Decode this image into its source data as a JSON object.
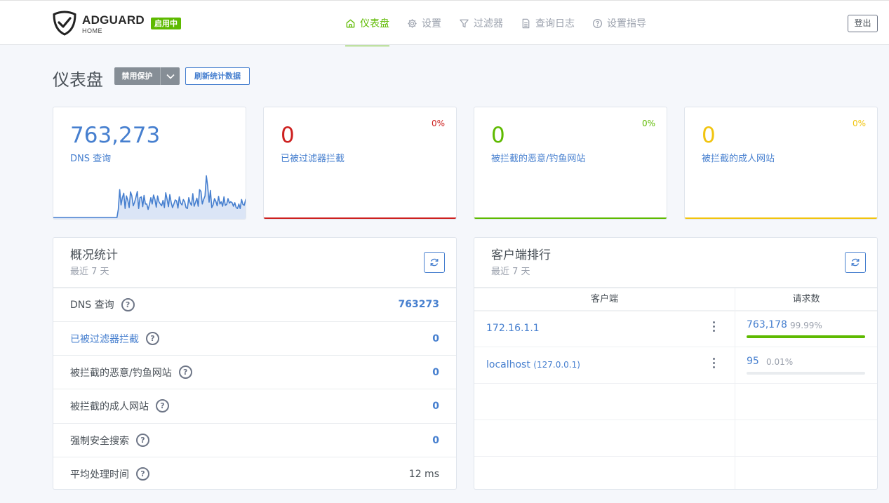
{
  "header": {
    "brand": "ADGUARD",
    "brand_sub": "HOME",
    "status_badge": "启用中",
    "nav": [
      {
        "label": "仪表盘",
        "icon": "home-icon",
        "active": true
      },
      {
        "label": "设置",
        "icon": "gear-icon",
        "active": false
      },
      {
        "label": "过滤器",
        "icon": "filter-icon",
        "active": false
      },
      {
        "label": "查询日志",
        "icon": "document-icon",
        "active": false
      },
      {
        "label": "设置指导",
        "icon": "help-icon",
        "active": false
      }
    ],
    "logout": "登出"
  },
  "page": {
    "title": "仪表盘",
    "disable_protection": "禁用保护",
    "refresh_stats": "刷新统计数据"
  },
  "stats": [
    {
      "value": "763,273",
      "label": "DNS 查询",
      "percent": "",
      "color": "#467fcf"
    },
    {
      "value": "0",
      "label": "已被过滤器拦截",
      "percent": "0%",
      "color": "#cd201f"
    },
    {
      "value": "0",
      "label": "被拦截的恶意/钓鱼网站",
      "percent": "0%",
      "color": "#5eba00"
    },
    {
      "value": "0",
      "label": "被拦截的成人网站",
      "percent": "0%",
      "color": "#f1c40f"
    }
  ],
  "sparkline": [
    0,
    0,
    0,
    0,
    0,
    0,
    0,
    0,
    0,
    0,
    0,
    0,
    0,
    0,
    0,
    0,
    0,
    0,
    0,
    0,
    0,
    0,
    0,
    0,
    0,
    0,
    0,
    0,
    0,
    0,
    0,
    0,
    0,
    0,
    0,
    0,
    0,
    0,
    0,
    0,
    0,
    0,
    0,
    0,
    0,
    0,
    0,
    0,
    18,
    62,
    28,
    44,
    54,
    20,
    48,
    38,
    22,
    57,
    48,
    26,
    34,
    45,
    58,
    20,
    44,
    46,
    24,
    49,
    30,
    30,
    18,
    29,
    44,
    30,
    50,
    40,
    23,
    48,
    35,
    30,
    26,
    38,
    22,
    55,
    41,
    24,
    51,
    34,
    22,
    30,
    39,
    37,
    21,
    46,
    32,
    28,
    40,
    35,
    22,
    20,
    44,
    33,
    27,
    53,
    25,
    34,
    43,
    25,
    62,
    58,
    30,
    40,
    48,
    93,
    69,
    34,
    60,
    22,
    28,
    42,
    36,
    26,
    47,
    30,
    35,
    25,
    46,
    27,
    29,
    42,
    32,
    35,
    33,
    25,
    33,
    22,
    20,
    30,
    20,
    40,
    29,
    27,
    40,
    44
  ],
  "overview": {
    "title": "概况统计",
    "subtitle": "最近 7 天",
    "rows": [
      {
        "label": "DNS 查询",
        "value": "763273"
      },
      {
        "label": "已被过滤器拦截",
        "value": "0"
      },
      {
        "label": "被拦截的恶意/钓鱼网站",
        "value": "0"
      },
      {
        "label": "被拦截的成人网站",
        "value": "0"
      },
      {
        "label": "强制安全搜索",
        "value": "0"
      },
      {
        "label": "平均处理时间",
        "value": "12 ms"
      }
    ],
    "help_glyph": "?"
  },
  "clients": {
    "title": "客户端排行",
    "subtitle": "最近 7 天",
    "col_client": "客户端",
    "col_requests": "请求数",
    "rows": [
      {
        "name": "172.16.1.1",
        "ip": "",
        "count": "763,178",
        "percent": "99.99%",
        "fill": 0.9999
      },
      {
        "name": "localhost",
        "ip": "(127.0.0.1)",
        "count": "95",
        "percent": "0.01%",
        "fill": 0.0001
      }
    ]
  }
}
